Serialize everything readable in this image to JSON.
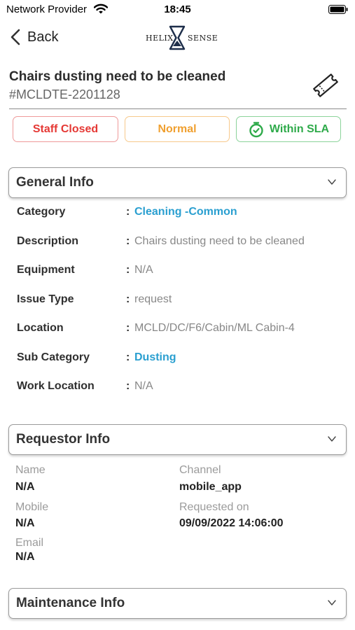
{
  "status_bar": {
    "carrier": "Network Provider",
    "time": "18:45",
    "icons": [
      "wifi-icon",
      "battery-icon"
    ]
  },
  "nav": {
    "back_label": "Back",
    "logo_left": "HELIX",
    "logo_right": "SENSE"
  },
  "ticket": {
    "title": "Chairs dusting need to be cleaned",
    "number": "#MCLDTE-2201128",
    "icon": "ticket-icon"
  },
  "pills": {
    "status": "Staff Closed",
    "priority": "Normal",
    "sla": "Within SLA",
    "sla_icon": "stopwatch-icon"
  },
  "colors": {
    "status": "#e53935",
    "priority": "#f0a030",
    "sla": "#2eaa4a",
    "link": "#2a9fd0"
  },
  "general_info": {
    "title": "General Info",
    "colon": ":",
    "rows": [
      {
        "label": "Category",
        "value": "Cleaning -Common",
        "link": true
      },
      {
        "label": "Description",
        "value": "Chairs dusting need to be cleaned",
        "link": false
      },
      {
        "label": "Equipment",
        "value": "N/A",
        "link": false
      },
      {
        "label": "Issue Type",
        "value": "request",
        "link": false
      },
      {
        "label": "Location",
        "value": "MCLD/DC/F6/Cabin/ML Cabin-4",
        "link": false
      },
      {
        "label": "Sub Category",
        "value": "Dusting",
        "link": true
      },
      {
        "label": "Work Location",
        "value": "N/A",
        "link": false
      }
    ]
  },
  "requestor_info": {
    "title": "Requestor Info",
    "name_label": "Name",
    "name_value": "N/A",
    "channel_label": "Channel",
    "channel_value": "mobile_app",
    "mobile_label": "Mobile",
    "mobile_value": "N/A",
    "requested_on_label": "Requested on",
    "requested_on_value": "09/09/2022 14:06:00",
    "email_label": "Email",
    "email_value": "N/A"
  },
  "maintenance_info": {
    "title": "Maintenance Info"
  }
}
